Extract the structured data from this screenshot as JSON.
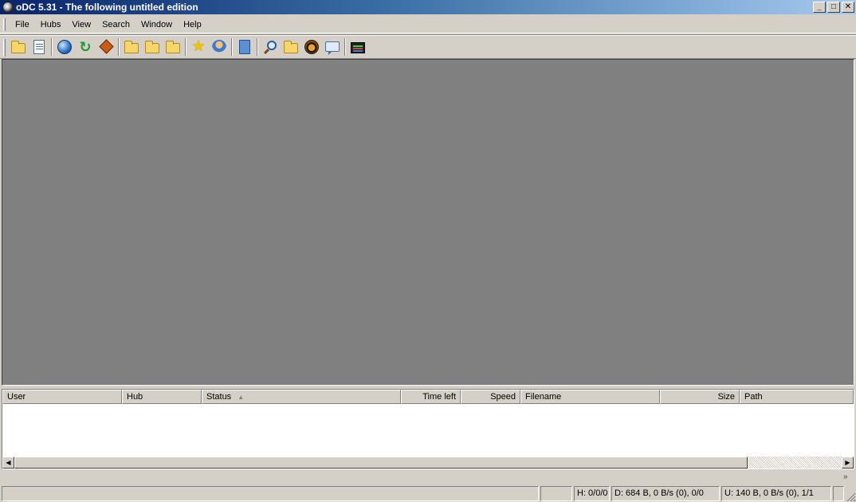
{
  "window": {
    "title": "oDC 5.31 - The following untitled edition",
    "buttons": {
      "minimize": "_",
      "maximize": "□",
      "close": "✕"
    }
  },
  "menu": [
    "File",
    "Hubs",
    "View",
    "Search",
    "Window",
    "Help"
  ],
  "toolbar": {
    "groups": [
      [
        "open-folder-icon",
        "notepad-icon"
      ],
      [
        "public-hubs-globe-icon",
        "reconnect-refresh-icon",
        "follow-redirect-diamond-icon"
      ],
      [
        "open-file-list-folder-icon",
        "open-own-list-folder-icon",
        "browse-folder-icon"
      ],
      [
        "favorite-hubs-star-icon",
        "favorite-users-icon"
      ],
      [
        "queue-book-icon"
      ],
      [
        "search-magnifier-icon",
        "adl-search-icon",
        "search-spy-icon",
        "notepad-chat-icon"
      ],
      [
        "network-stats-icon"
      ]
    ]
  },
  "transfers": {
    "columns": [
      {
        "label": "User",
        "align": "left"
      },
      {
        "label": "Hub",
        "align": "left"
      },
      {
        "label": "Status",
        "align": "left",
        "sorted": true
      },
      {
        "label": "Time left",
        "align": "right"
      },
      {
        "label": "Speed",
        "align": "right"
      },
      {
        "label": "Filename",
        "align": "left"
      },
      {
        "label": "Size",
        "align": "right"
      },
      {
        "label": "Path",
        "align": "left"
      }
    ],
    "sort_indicator": "▲",
    "rows": []
  },
  "scroll": {
    "left": "◀",
    "right": "▶"
  },
  "chevron": "»",
  "statusbar": {
    "main": "",
    "blank": "",
    "hubs": "H: 0/0/0",
    "download": "D: 684 B, 0 B/s (0), 0/0",
    "upload": "U: 140 B, 0 B/s (0), 1/1",
    "extra": ""
  }
}
